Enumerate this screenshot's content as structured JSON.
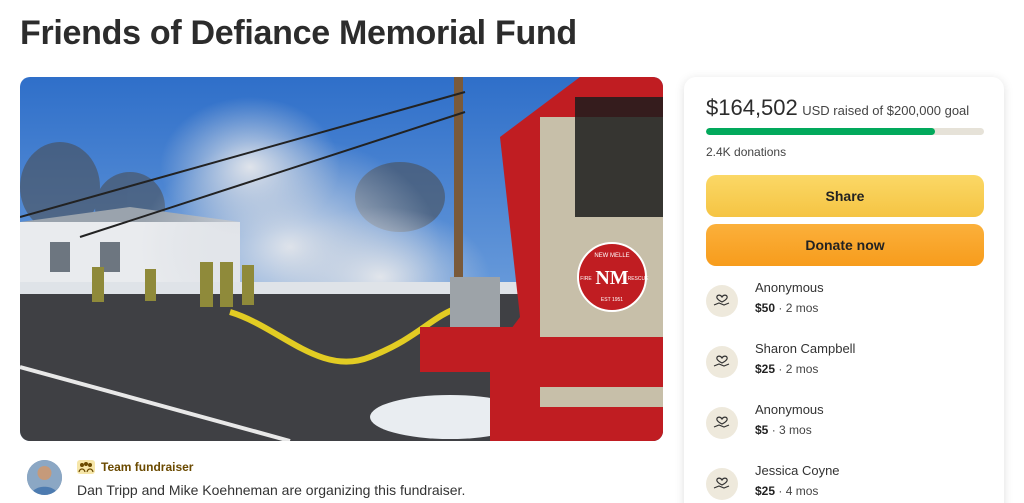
{
  "campaign": {
    "title": "Friends of Defiance Memorial Fund"
  },
  "hero_image": {
    "truck_badge_top": "NEW MELLE",
    "truck_badge_monogram": "NM",
    "truck_badge_left": "FIRE",
    "truck_badge_right": "RESCUE",
    "truck_badge_bottom": "EST 1951"
  },
  "organizer": {
    "badge_label": "Team fundraiser",
    "text": "Dan Tripp and Mike Koehneman are organizing this fundraiser."
  },
  "donation_card": {
    "amount_raised": "$164,502",
    "goal_text": "USD raised of $200,000 goal",
    "progress_fraction": 0.822,
    "donation_count": "2.4K donations",
    "share_label": "Share",
    "donate_label": "Donate now",
    "accent_color": "#02a95c",
    "donors": [
      {
        "name": "Anonymous",
        "amount": "$50",
        "time": " · 2 mos"
      },
      {
        "name": "Sharon Campbell",
        "amount": "$25",
        "time": " · 2 mos"
      },
      {
        "name": "Anonymous",
        "amount": "$5",
        "time": " · 3 mos"
      },
      {
        "name": "Jessica Coyne",
        "amount": "$25",
        "time": " · 4 mos"
      }
    ]
  }
}
